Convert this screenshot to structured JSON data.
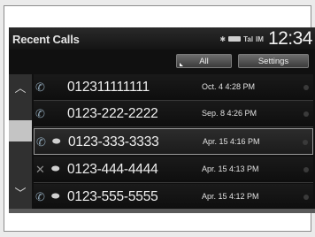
{
  "header": {
    "title": "Recent Calls",
    "bluetooth_icon": "bluetooth-icon",
    "signal_text": "Tal",
    "network_text": "IM",
    "clock": "12:34"
  },
  "tabs": {
    "all_label": "All",
    "settings_label": "Settings"
  },
  "calls": [
    {
      "type": "incoming-call-icon",
      "hfl": false,
      "number": "012311111111",
      "when": "Oct. 4 4:28 PM"
    },
    {
      "type": "incoming-call-icon",
      "hfl": false,
      "number": "0123-222-2222",
      "when": "Sep. 8 4:26 PM"
    },
    {
      "type": "incoming-call-icon",
      "hfl": true,
      "number": "0123-333-3333",
      "when": "Apr. 15 4:16 PM"
    },
    {
      "type": "missed-call-icon",
      "hfl": true,
      "number": "0123-444-4444",
      "when": "Apr. 15 4:13 PM"
    },
    {
      "type": "incoming-call-icon",
      "hfl": true,
      "number": "0123-555-5555",
      "when": "Apr. 15 4:12 PM"
    }
  ]
}
